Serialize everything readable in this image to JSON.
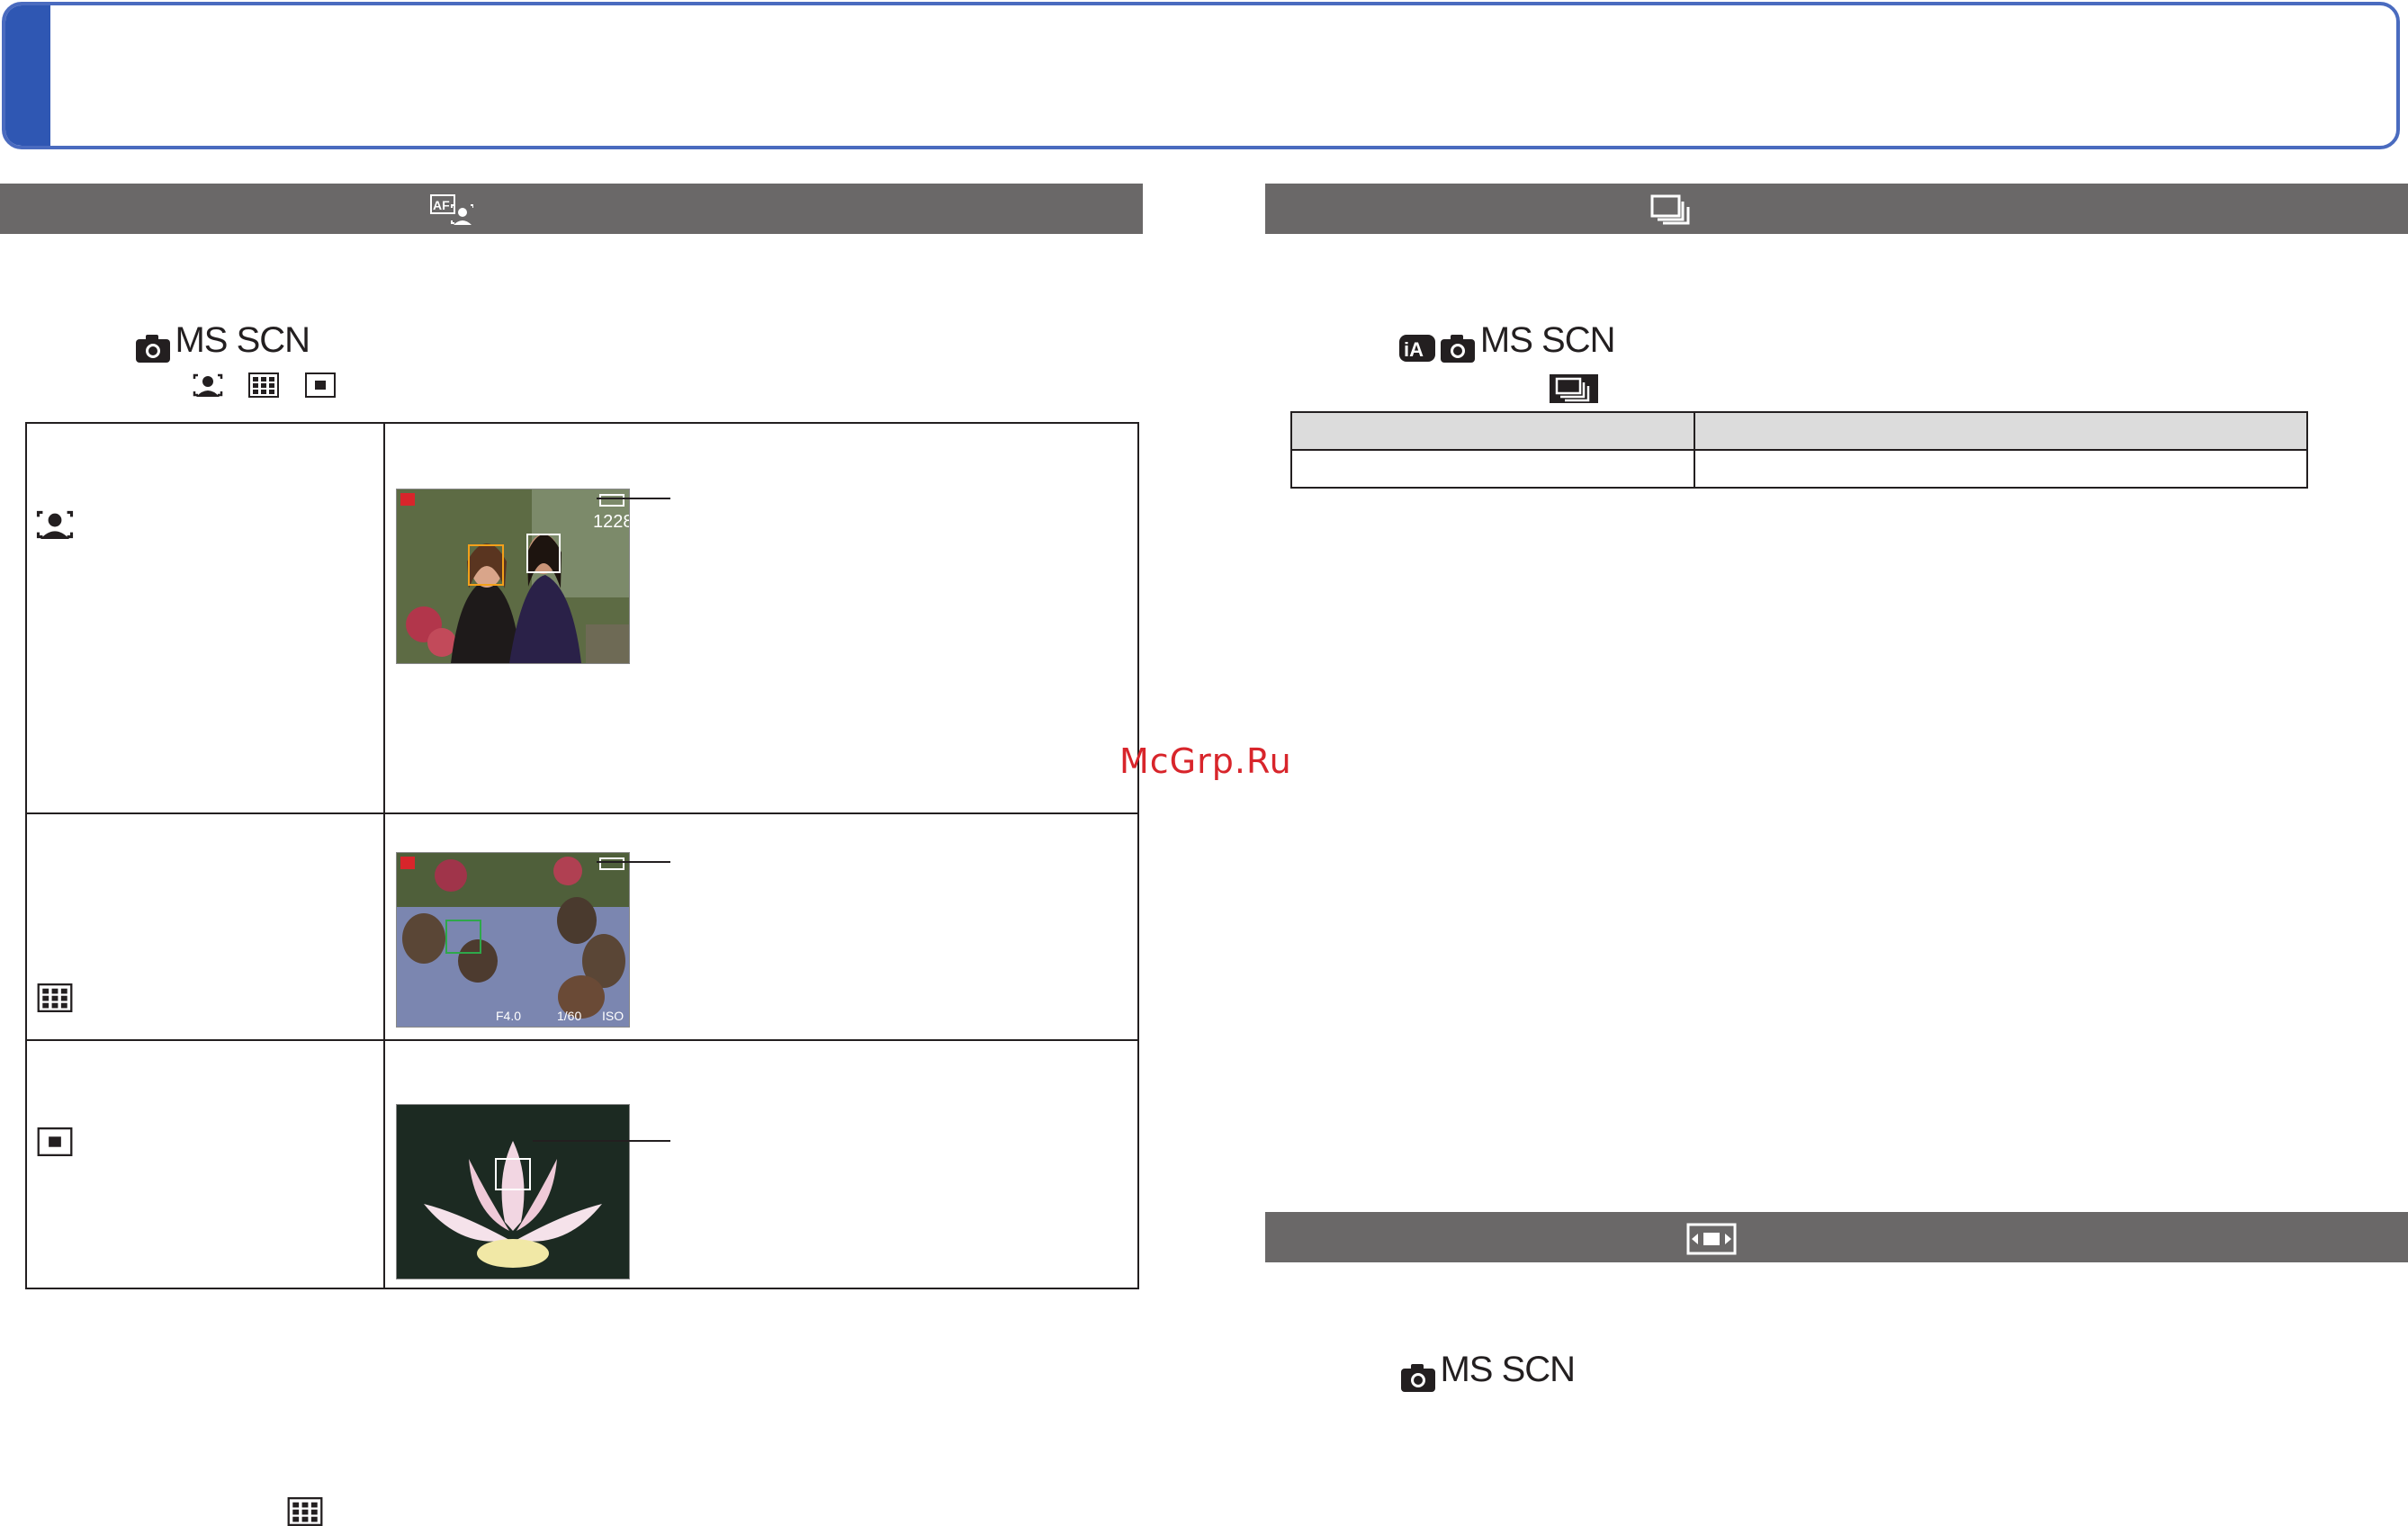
{
  "watermark": "McGrp.Ru",
  "colors": {
    "title_border": "#4a6bbf",
    "title_tab": "#2f57b3",
    "section_bar": "#6a6868",
    "table_header": "#dcdcdc",
    "watermark": "#d8252b"
  },
  "sections": {
    "af_mode": {
      "bar_icon": "af-face-detection-icon",
      "modes_label": "MS SCN",
      "mode_icons": [
        "camera-icon"
      ],
      "option_icons": [
        "face-detection-icon",
        "23-area-af-icon",
        "1-area-af-icon"
      ],
      "rows": [
        {
          "icon": "face-detection-icon",
          "has_photo": true,
          "photo": "two-women-garden-face-detection",
          "overlay_number": "1228"
        },
        {
          "icon": "23-area-af-icon",
          "has_photo": true,
          "photo": "raccoon-dogs-23-area-af",
          "overlay_values": [
            "F4.0",
            "1/60",
            "ISO"
          ]
        },
        {
          "icon": "1-area-af-icon",
          "has_photo": true,
          "photo": "lotus-flower-1-area-af"
        }
      ],
      "footer_icon": "23-area-af-icon"
    },
    "burst": {
      "bar_icon": "burst-icon",
      "modes_label": "MS SCN",
      "mode_icons": [
        "intelligent-auto-icon",
        "camera-icon"
      ],
      "setting_icon": "burst-icon",
      "table": {
        "rows": 2,
        "cols": 2
      }
    },
    "aspect": {
      "bar_icon": "aspect-ratio-icon",
      "modes_label": "MS SCN",
      "mode_icons": [
        "camera-icon"
      ]
    }
  }
}
